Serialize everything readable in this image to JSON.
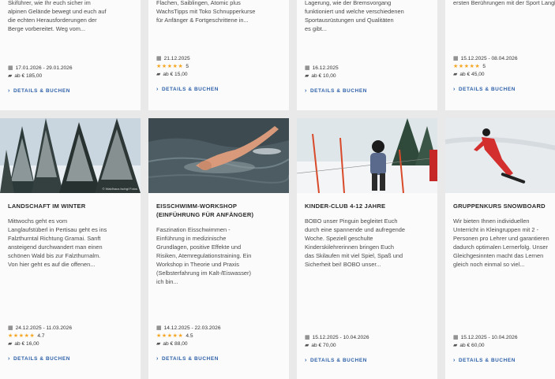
{
  "top_cards": [
    {
      "desc": "Skiführer, wie Ihr euch sicher im\nalpinen Gelände bewegt und euch auf\ndie echten Herausforderungen der\nBerge vorbereitet. Weg vom...",
      "date": "17.01.2026 - 29.01.2026",
      "rating": "",
      "price": "ab € 185,00",
      "link": "DETAILS & BUCHEN"
    },
    {
      "desc": "Flachen, Saiblingen, Atomic plus\nWachsTipps mit Toko Schnupperkurse\nfür Anfänger & Fortgeschrittene in...",
      "date": "21.12.2025",
      "rating": "5",
      "price": "ab € 15,00",
      "link": "DETAILS & BUCHEN"
    },
    {
      "desc": "Lagerung, wie der Bremsvorgang\nfunktioniert und welche verschiedenen\nSportausrüstungen und Qualitäten\nes gibt...",
      "date": "16.12.2025",
      "rating": "",
      "price": "ab € 10,00",
      "link": "DETAILS & BUCHEN"
    },
    {
      "desc": "ersten Berührungen mit der Sport\nLanglauf. Nutzen Sie unsere\npraktischen Paketangebote für Ihre\nersten Berührungen mit der Sport\nLanglauf...",
      "date": "15.12.2025 - 08.04.2026",
      "rating": "5",
      "price": "ab € 45,00",
      "link": "DETAILS & BUCHEN"
    }
  ],
  "bottom_cards": [
    {
      "title": "LANDSCHAFT IM WINTER",
      "watermark": "© Waldhaus Ischgl Fotos",
      "desc": "Mittwochs geht es vom\nLanglaufstüberl in Pertisau geht es ins\nFalzthurntal Richtung Gramai. Sanft\nansteigend durchwandert man einen\nschönen Wald bis zur Falzthurnalm.\nVon hier geht es auf die offenen...",
      "date": "24.12.2025 - 11.03.2026",
      "rating": "4.7",
      "price": "ab € 16,00",
      "link": "DETAILS & BUCHEN"
    },
    {
      "title": "EISSCHWIMM-WORKSHOP (EINFÜHRUNG FÜR ANFÄNGER)",
      "desc": "Faszination Eisschwimmen -\nEinführung in medizinische\nGrundlagen, positive Effekte und\nRisiken, Atemregulationstraining. Ein\nWorkshop in Theorie und Praxis\n(Selbsterfahrung im Kalt-/Eiswasser)\nich bin...",
      "date": "14.12.2025 - 22.03.2026",
      "rating": "4.5",
      "price": "ab € 88,00",
      "link": "DETAILS & BUCHEN"
    },
    {
      "title": "KINDER-CLUB 4-12 JAHRE",
      "desc": "BOBO unser Pinguin begleitet Euch\ndurch eine spannende und aufregende\nWoche. Speziell geschulte\nKinderskilehrerinnen bringen Euch\ndas Skilaufen mit viel Spiel, Spaß und\nSicherheit bei! BOBO unser...",
      "date": "15.12.2025 - 10.04.2026",
      "rating": "",
      "price": "ab € 70,00",
      "link": "DETAILS & BUCHEN"
    },
    {
      "title": "GRUPPENKURS SNOWBOARD",
      "desc": "Wir bieten Ihnen individuellen\nUnterricht in Kleingruppen mit 2 -\nPersonen pro Lehrer und garantieren\ndadurch optimalen Lernerfolg. Unser\nGleichgesinnten macht das Lernen\ngleich noch einmal so viel...",
      "date": "15.12.2025 - 10.04.2026",
      "rating": "",
      "price": "ab € 60,00",
      "link": "DETAILS & BUCHEN"
    }
  ],
  "icons": {
    "calendar": "calendar-icon",
    "ticket": "ticket-icon",
    "star": "star-icon",
    "chevron": "chevron-right-icon"
  },
  "colors": {
    "link": "#2c5fa8",
    "star": "#f5a623",
    "background": "#e9e9ea",
    "card": "#fbfbfb"
  }
}
